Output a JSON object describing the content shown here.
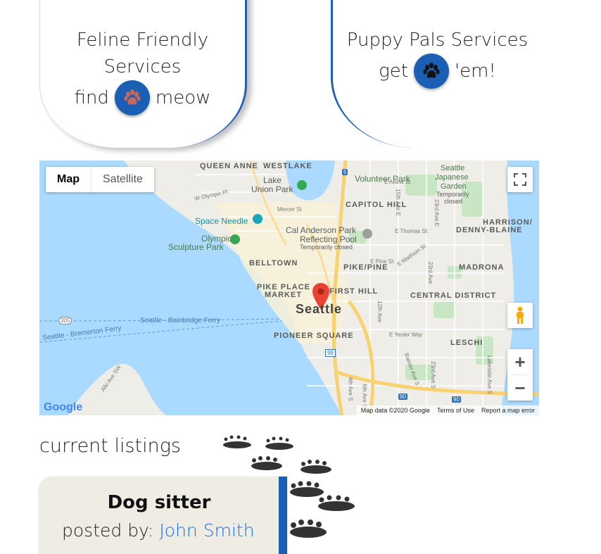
{
  "services": {
    "feline": {
      "title_line1": "Feline Friendly",
      "title_line2": "Services",
      "action_prefix": "find",
      "action_suffix": "meow"
    },
    "puppy": {
      "title_line1": "Puppy Pals Services",
      "action_prefix": "get",
      "action_suffix": "'em!"
    }
  },
  "map": {
    "type_control": {
      "map_label": "Map",
      "satellite_label": "Satellite",
      "selected": "Map"
    },
    "labels": {
      "queen_anne": "QUEEN ANNE",
      "westlake": "WESTLAKE",
      "lake_union_park_1": "Lake",
      "lake_union_park_2": "Union Park",
      "volunteer_park": "Volunteer Park",
      "japanese_garden_1": "Seattle",
      "japanese_garden_2": "Japanese",
      "japanese_garden_3": "Garden",
      "japanese_garden_4": "Temporarily",
      "japanese_garden_5": "closed",
      "capitol_hill": "CAPITOL HILL",
      "space_needle": "Space Needle",
      "harrison_1": "HARRISON/",
      "harrison_2": "DENNY-BLAINE",
      "cal_anderson_1": "Cal Anderson Park",
      "cal_anderson_2": "Reflecting Pool",
      "cal_anderson_3": "Temporarily closed",
      "olympic_sculpture_1": "Olympic",
      "olympic_sculpture_2": "Sculpture Park",
      "belltown": "BELLTOWN",
      "pike_pine": "PIKE/PINE",
      "madrona": "MADRONA",
      "pike_place_1": "PIKE PLACE",
      "pike_place_2": "MARKET",
      "first_hill": "FIRST HILL",
      "central_district": "CENTRAL DISTRICT",
      "seattle": "Seattle",
      "route_305": "305",
      "ferry_bainbridge": "Seattle - Bainbridge Ferry",
      "ferry_bremerton": "Seattle - Bremerton Ferry",
      "pioneer_square": "PIONEER SQUARE",
      "leschi": "LESCHI",
      "street_e_aloha": "E Aloha St",
      "street_e_thomas": "E Thomas St",
      "street_e_pine": "E Pine St",
      "street_e_madison": "E Madison St",
      "street_e_yesler": "E Yesler Way",
      "street_w_olympic": "W Olympic Pl",
      "street_mercer": "Mercer St",
      "street_23rd_1": "23rd Ave E",
      "street_23rd_2": "23rd Ave",
      "street_23rd_3": "23rd Ave S",
      "street_12th": "12th Ave",
      "street_15th": "15th Ave E",
      "street_rainier": "Rainier Ave S",
      "street_lakeside": "Lakeside Ave S",
      "street_4th": "4th Ave S",
      "street_6th": "6th Ave S",
      "street_alki": "Alki Ave SW",
      "route_90a": "90",
      "route_90b": "90",
      "route_5": "5",
      "route_99": "99"
    },
    "attribution": {
      "logo": "Google",
      "map_data": "Map data ©2020 Google",
      "terms": "Terms of Use",
      "report": "Report a map error"
    },
    "zoom_in": "+",
    "zoom_out": "−"
  },
  "listings": {
    "heading": "current listings",
    "items": [
      {
        "title": "Dog sitter",
        "posted_by_label": "posted by:",
        "author": "John Smith"
      }
    ]
  },
  "colors": {
    "accent": "#1a5fb4",
    "listing_bg": "#efece3",
    "water": "#aadaff",
    "park": "#c8e6c3",
    "land": "#eeede8"
  }
}
